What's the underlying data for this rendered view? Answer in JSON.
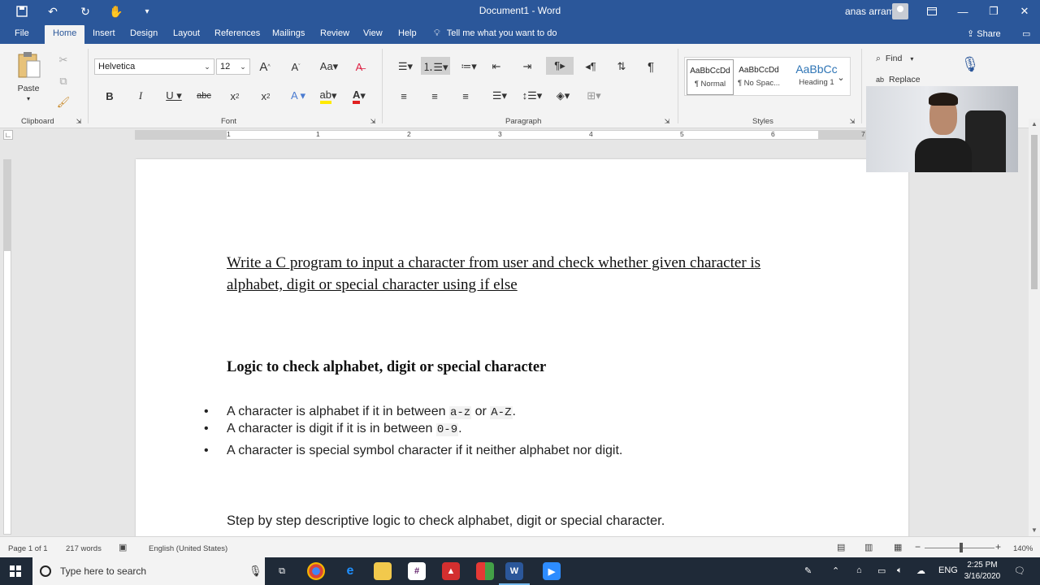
{
  "titlebar": {
    "doc_title": "Document1 - Word",
    "user_name": "anas arram"
  },
  "tabs": {
    "file": "File",
    "home": "Home",
    "insert": "Insert",
    "design": "Design",
    "layout": "Layout",
    "references": "References",
    "mailings": "Mailings",
    "review": "Review",
    "view": "View",
    "help": "Help",
    "tell_me": "Tell me what you want to do",
    "share": "Share"
  },
  "ribbon": {
    "paste_label": "Paste",
    "font_name": "Helvetica",
    "font_size": "12",
    "groups": {
      "clipboard": "Clipboard",
      "font": "Font",
      "paragraph": "Paragraph",
      "styles": "Styles"
    },
    "styles": [
      {
        "sample": "AaBbCcDd",
        "name": "¶ Normal"
      },
      {
        "sample": "AaBbCcDd",
        "name": "¶ No Spac..."
      },
      {
        "sample": "AaBbCc",
        "name": "Heading 1"
      }
    ],
    "find": "Find",
    "replace": "Replace"
  },
  "ruler": {
    "numbers": [
      "1",
      "1",
      "2",
      "3",
      "4",
      "5",
      "6",
      "7"
    ]
  },
  "document": {
    "title": "Write a C program to input a character from user and check whether given character is alphabet, digit or special character using if else",
    "heading": "Logic to check alphabet, digit or special character",
    "bullet1_a": "A character is alphabet if it in between ",
    "bullet1_code1": "a-z",
    "bullet1_b": " or ",
    "bullet1_code2": "A-Z",
    "bullet1_c": ".",
    "bullet2_a": "A character is digit if it is in between ",
    "bullet2_code": "0-9",
    "bullet2_b": ".",
    "bullet3": "A character is special symbol character if it neither alphabet nor digit.",
    "step": "Step by step descriptive logic to check alphabet, digit or special character."
  },
  "statusbar": {
    "page": "Page 1 of 1",
    "words": "217 words",
    "language": "English (United States)",
    "zoom": "140%"
  },
  "taskbar": {
    "search_placeholder": "Type here to search",
    "lang": "ENG",
    "time": "2:25 PM",
    "date": "3/16/2020"
  },
  "colors": {
    "word_blue": "#2b579a",
    "taskbar": "#1f2a38"
  }
}
